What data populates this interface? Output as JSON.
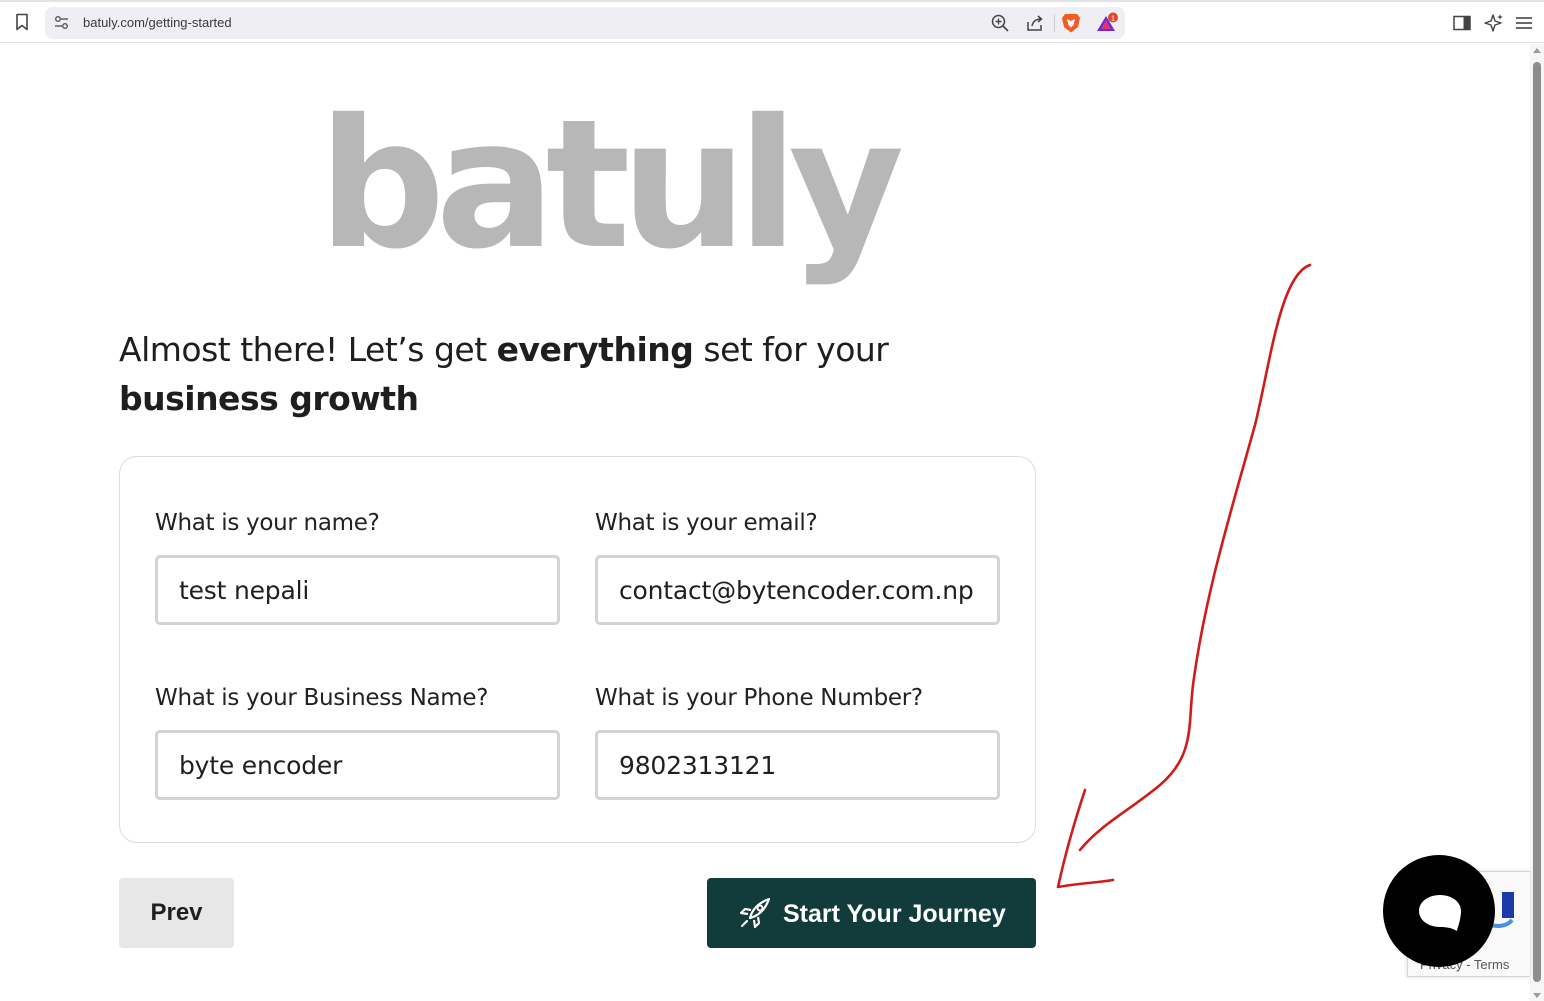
{
  "browser": {
    "url": "batuly.com/getting-started",
    "rewards_badge": "1",
    "icons": [
      "bookmark-icon",
      "site-settings-icon",
      "zoom-icon",
      "share-icon",
      "brave-shields-icon",
      "brave-rewards-icon",
      "sidebar-icon",
      "leo-ai-icon",
      "menu-icon"
    ]
  },
  "page": {
    "logo_text": "batuly",
    "headline": {
      "part1": "Almost there! Let’s get ",
      "bold1": "everything",
      "part2": " set for your ",
      "bold2": "business growth"
    },
    "form": {
      "name_label": "What is your name?",
      "name_value": "test nepali",
      "email_label": "What is your email?",
      "email_value": "contact@bytencoder.com.np",
      "business_label": "What is your Business Name?",
      "business_value": "byte encoder",
      "phone_label": "What is your Phone Number?",
      "phone_value": "9802313121"
    },
    "prev_button": "Prev",
    "start_button": "Start Your Journey",
    "recaptcha_links": "Privacy - Terms"
  },
  "colors": {
    "primary_button": "#123b3b",
    "logo": "#b7b7b7",
    "annotation": "#d11b1b"
  }
}
